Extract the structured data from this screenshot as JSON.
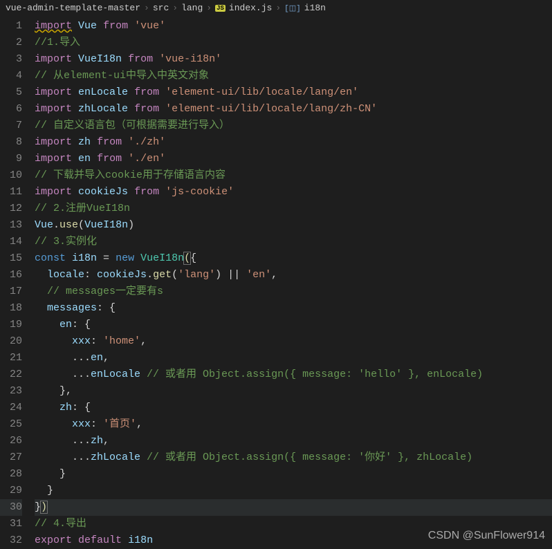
{
  "breadcrumb": {
    "root": "vue-admin-template-master",
    "src": "src",
    "lang": "lang",
    "file": "index.js",
    "symbol": "i18n"
  },
  "lines": [
    {
      "n": 1,
      "t": [
        {
          "c": "keyword squiggle",
          "v": "import"
        },
        {
          "c": "punct",
          "v": " "
        },
        {
          "c": "variable",
          "v": "Vue"
        },
        {
          "c": "punct",
          "v": " "
        },
        {
          "c": "keyword",
          "v": "from"
        },
        {
          "c": "punct",
          "v": " "
        },
        {
          "c": "string",
          "v": "'vue'"
        }
      ]
    },
    {
      "n": 2,
      "t": [
        {
          "c": "comment",
          "v": "//1.导入"
        }
      ]
    },
    {
      "n": 3,
      "t": [
        {
          "c": "keyword",
          "v": "import"
        },
        {
          "c": "punct",
          "v": " "
        },
        {
          "c": "variable",
          "v": "VueI18n"
        },
        {
          "c": "punct",
          "v": " "
        },
        {
          "c": "keyword",
          "v": "from"
        },
        {
          "c": "punct",
          "v": " "
        },
        {
          "c": "string",
          "v": "'vue-i18n'"
        }
      ]
    },
    {
      "n": 4,
      "t": [
        {
          "c": "comment",
          "v": "// 从element-ui中导入中英文对象"
        }
      ]
    },
    {
      "n": 5,
      "t": [
        {
          "c": "keyword",
          "v": "import"
        },
        {
          "c": "punct",
          "v": " "
        },
        {
          "c": "variable",
          "v": "enLocale"
        },
        {
          "c": "punct",
          "v": " "
        },
        {
          "c": "keyword",
          "v": "from"
        },
        {
          "c": "punct",
          "v": " "
        },
        {
          "c": "string",
          "v": "'element-ui/lib/locale/lang/en'"
        }
      ]
    },
    {
      "n": 6,
      "t": [
        {
          "c": "keyword",
          "v": "import"
        },
        {
          "c": "punct",
          "v": " "
        },
        {
          "c": "variable",
          "v": "zhLocale"
        },
        {
          "c": "punct",
          "v": " "
        },
        {
          "c": "keyword",
          "v": "from"
        },
        {
          "c": "punct",
          "v": " "
        },
        {
          "c": "string",
          "v": "'element-ui/lib/locale/lang/zh-CN'"
        }
      ]
    },
    {
      "n": 7,
      "t": [
        {
          "c": "comment",
          "v": "// 自定义语言包（可根据需要进行导入）"
        }
      ]
    },
    {
      "n": 8,
      "t": [
        {
          "c": "keyword",
          "v": "import"
        },
        {
          "c": "punct",
          "v": " "
        },
        {
          "c": "variable",
          "v": "zh"
        },
        {
          "c": "punct",
          "v": " "
        },
        {
          "c": "keyword",
          "v": "from"
        },
        {
          "c": "punct",
          "v": " "
        },
        {
          "c": "string",
          "v": "'./zh'"
        }
      ]
    },
    {
      "n": 9,
      "t": [
        {
          "c": "keyword",
          "v": "import"
        },
        {
          "c": "punct",
          "v": " "
        },
        {
          "c": "variable",
          "v": "en"
        },
        {
          "c": "punct",
          "v": " "
        },
        {
          "c": "keyword",
          "v": "from"
        },
        {
          "c": "punct",
          "v": " "
        },
        {
          "c": "string",
          "v": "'./en'"
        }
      ]
    },
    {
      "n": 10,
      "t": [
        {
          "c": "comment",
          "v": "// 下载并导入cookie用于存储语言内容"
        }
      ]
    },
    {
      "n": 11,
      "t": [
        {
          "c": "keyword",
          "v": "import"
        },
        {
          "c": "punct",
          "v": " "
        },
        {
          "c": "variable",
          "v": "cookieJs"
        },
        {
          "c": "punct",
          "v": " "
        },
        {
          "c": "keyword",
          "v": "from"
        },
        {
          "c": "punct",
          "v": " "
        },
        {
          "c": "string",
          "v": "'js-cookie'"
        }
      ]
    },
    {
      "n": 12,
      "t": [
        {
          "c": "comment",
          "v": "// 2.注册VueI18n"
        }
      ]
    },
    {
      "n": 13,
      "t": [
        {
          "c": "variable",
          "v": "Vue"
        },
        {
          "c": "punct",
          "v": "."
        },
        {
          "c": "function",
          "v": "use"
        },
        {
          "c": "punct",
          "v": "("
        },
        {
          "c": "variable",
          "v": "VueI18n"
        },
        {
          "c": "punct",
          "v": ")"
        }
      ]
    },
    {
      "n": 14,
      "t": [
        {
          "c": "comment",
          "v": "// 3.实例化"
        }
      ]
    },
    {
      "n": 15,
      "t": [
        {
          "c": "const",
          "v": "const"
        },
        {
          "c": "punct",
          "v": " "
        },
        {
          "c": "variable",
          "v": "i18n"
        },
        {
          "c": "punct",
          "v": " = "
        },
        {
          "c": "const",
          "v": "new"
        },
        {
          "c": "punct",
          "v": " "
        },
        {
          "c": "type",
          "v": "VueI18n"
        },
        {
          "c": "function paren-hl",
          "v": "("
        },
        {
          "c": "punct",
          "v": "{"
        }
      ]
    },
    {
      "n": 16,
      "t": [
        {
          "c": "punct",
          "v": "  "
        },
        {
          "c": "prop",
          "v": "locale"
        },
        {
          "c": "punct",
          "v": ": "
        },
        {
          "c": "variable",
          "v": "cookieJs"
        },
        {
          "c": "punct",
          "v": "."
        },
        {
          "c": "function",
          "v": "get"
        },
        {
          "c": "punct",
          "v": "("
        },
        {
          "c": "string",
          "v": "'lang'"
        },
        {
          "c": "punct",
          "v": ") || "
        },
        {
          "c": "string",
          "v": "'en'"
        },
        {
          "c": "punct",
          "v": ","
        }
      ]
    },
    {
      "n": 17,
      "t": [
        {
          "c": "punct",
          "v": "  "
        },
        {
          "c": "comment",
          "v": "// messages一定要有s"
        }
      ]
    },
    {
      "n": 18,
      "t": [
        {
          "c": "punct",
          "v": "  "
        },
        {
          "c": "prop",
          "v": "messages"
        },
        {
          "c": "punct",
          "v": ": {"
        }
      ]
    },
    {
      "n": 19,
      "t": [
        {
          "c": "punct",
          "v": "    "
        },
        {
          "c": "prop",
          "v": "en"
        },
        {
          "c": "punct",
          "v": ": {"
        }
      ]
    },
    {
      "n": 20,
      "t": [
        {
          "c": "punct",
          "v": "      "
        },
        {
          "c": "prop",
          "v": "xxx"
        },
        {
          "c": "punct",
          "v": ": "
        },
        {
          "c": "string",
          "v": "'home'"
        },
        {
          "c": "punct",
          "v": ","
        }
      ]
    },
    {
      "n": 21,
      "t": [
        {
          "c": "punct",
          "v": "      ..."
        },
        {
          "c": "variable",
          "v": "en"
        },
        {
          "c": "punct",
          "v": ","
        }
      ]
    },
    {
      "n": 22,
      "t": [
        {
          "c": "punct",
          "v": "      ..."
        },
        {
          "c": "variable",
          "v": "enLocale"
        },
        {
          "c": "punct",
          "v": " "
        },
        {
          "c": "comment",
          "v": "// 或者用 Object.assign({ message: 'hello' }, enLocale)"
        }
      ]
    },
    {
      "n": 23,
      "t": [
        {
          "c": "punct",
          "v": "    },"
        }
      ]
    },
    {
      "n": 24,
      "t": [
        {
          "c": "punct",
          "v": "    "
        },
        {
          "c": "prop",
          "v": "zh"
        },
        {
          "c": "punct",
          "v": ": {"
        }
      ]
    },
    {
      "n": 25,
      "t": [
        {
          "c": "punct",
          "v": "      "
        },
        {
          "c": "prop",
          "v": "xxx"
        },
        {
          "c": "punct",
          "v": ": "
        },
        {
          "c": "string",
          "v": "'首页'"
        },
        {
          "c": "punct",
          "v": ","
        }
      ]
    },
    {
      "n": 26,
      "t": [
        {
          "c": "punct",
          "v": "      ..."
        },
        {
          "c": "variable",
          "v": "zh"
        },
        {
          "c": "punct",
          "v": ","
        }
      ]
    },
    {
      "n": 27,
      "t": [
        {
          "c": "punct",
          "v": "      ..."
        },
        {
          "c": "variable",
          "v": "zhLocale"
        },
        {
          "c": "punct",
          "v": " "
        },
        {
          "c": "comment",
          "v": "// 或者用 Object.assign({ message: '你好' }, zhLocale)"
        }
      ]
    },
    {
      "n": 28,
      "t": [
        {
          "c": "punct",
          "v": "    }"
        }
      ]
    },
    {
      "n": 29,
      "t": [
        {
          "c": "punct",
          "v": "  }"
        }
      ]
    },
    {
      "n": 30,
      "hl": true,
      "t": [
        {
          "c": "punct",
          "v": "}"
        },
        {
          "c": "function paren-hl",
          "v": ")"
        }
      ]
    },
    {
      "n": 31,
      "t": [
        {
          "c": "comment",
          "v": "// 4.导出"
        }
      ]
    },
    {
      "n": 32,
      "t": [
        {
          "c": "keyword",
          "v": "export"
        },
        {
          "c": "punct",
          "v": " "
        },
        {
          "c": "keyword",
          "v": "default"
        },
        {
          "c": "punct",
          "v": " "
        },
        {
          "c": "variable",
          "v": "i18n"
        }
      ]
    }
  ],
  "watermark": "CSDN @SunFlower914"
}
